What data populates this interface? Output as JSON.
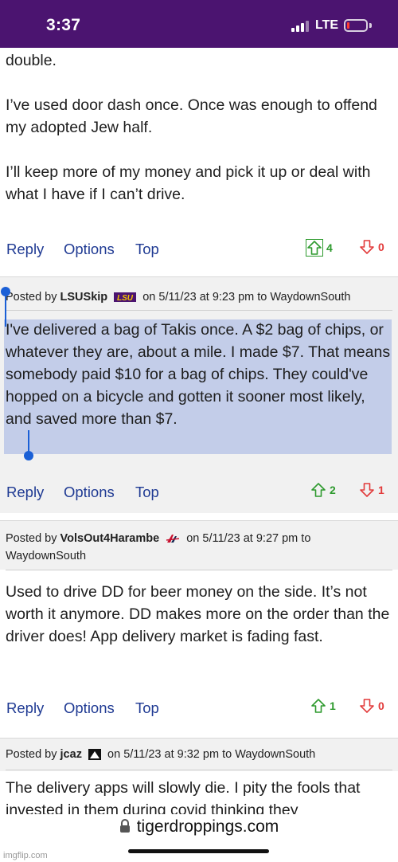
{
  "status_bar": {
    "time": "3:37",
    "network": "LTE"
  },
  "posts": [
    {
      "paragraphs": [
        "double.",
        "I’ve used door dash once. Once was enough to offend my adopted Jew half.",
        "I’ll keep more of my money and pick it up or deal with what I have if I can’t drive."
      ],
      "actions": {
        "reply": "Reply",
        "options": "Options",
        "top": "Top"
      },
      "upvotes": "4",
      "downvotes": "0"
    },
    {
      "posted_by_prefix": "Posted by",
      "author": "LSUSkip",
      "badge": "LSU",
      "date_prefix": "on",
      "date": "5/11/23 at 9:23 pm",
      "to_prefix": "to",
      "recipient": "WaydownSouth",
      "text": "I've delivered a bag of Takis once. A $2 bag of chips, or whatever they are, about a mile. I made $7. That means somebody paid $10 for a bag of chips. They could've hopped on a bicycle and gotten it sooner most likely, and saved more than $7.",
      "actions": {
        "reply": "Reply",
        "options": "Options",
        "top": "Top"
      },
      "upvotes": "2",
      "downvotes": "1"
    },
    {
      "posted_by_prefix": "Posted by",
      "author": "VolsOut4Harambe",
      "date_prefix": "on",
      "date": "5/11/23 at 9:27 pm",
      "to_prefix": "to",
      "recipient": "WaydownSouth",
      "text": "Used to drive DD for beer money on the side. It’s not worth it anymore. DD makes more on the order than the driver does! App delivery market is fading fast.",
      "actions": {
        "reply": "Reply",
        "options": "Options",
        "top": "Top"
      },
      "upvotes": "1",
      "downvotes": "0"
    },
    {
      "posted_by_prefix": "Posted by",
      "author": "jcaz",
      "date_prefix": "on",
      "date": "5/11/23 at 9:32 pm",
      "to_prefix": "to",
      "recipient": "WaydownSouth",
      "text": "The delivery apps will slowly die. I pity the fools that invested in them during covid thinking they"
    }
  ],
  "url_bar": {
    "domain": "tigerdroppings.com"
  },
  "watermark": "imgflip.com",
  "colors": {
    "status_bar_bg": "#4b1470",
    "link_blue": "#1f3a93",
    "upvote_green": "#2e9a2e",
    "downvote_red": "#e23a3a",
    "selection": "#c3cde9",
    "header_bg": "#f1f1f1"
  }
}
